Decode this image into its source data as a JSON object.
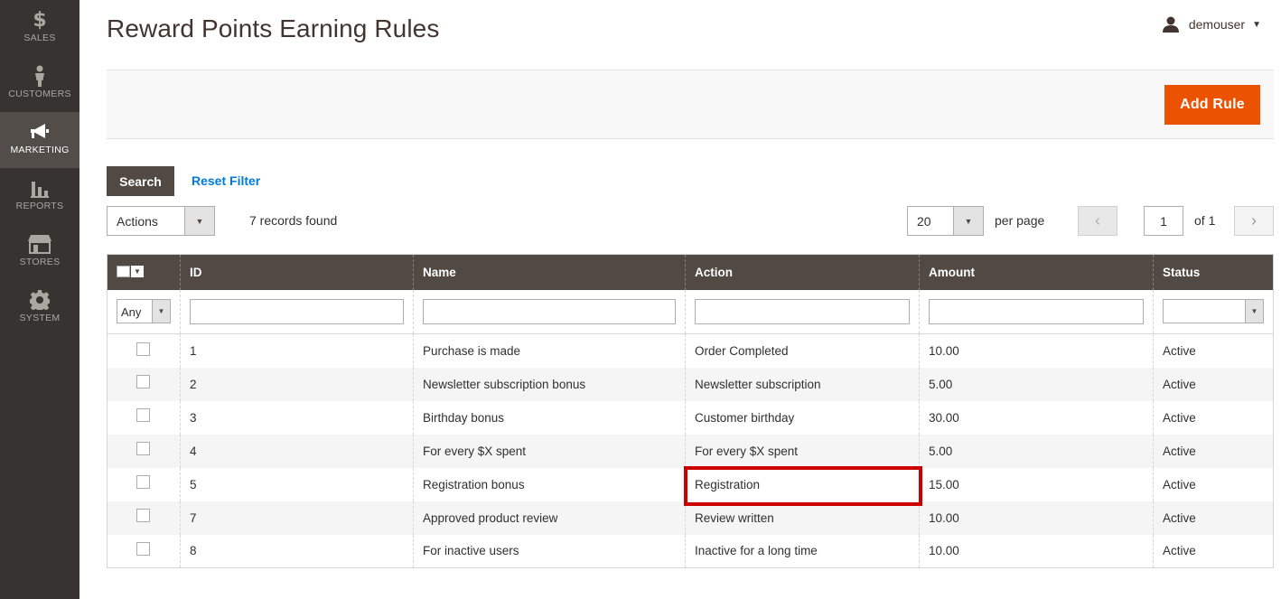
{
  "sidebar": {
    "items": [
      {
        "label": "SALES",
        "icon": "dollar-icon"
      },
      {
        "label": "CUSTOMERS",
        "icon": "person-icon"
      },
      {
        "label": "MARKETING",
        "icon": "megaphone-icon",
        "active": true
      },
      {
        "label": "REPORTS",
        "icon": "bar-chart-icon"
      },
      {
        "label": "STORES",
        "icon": "store-icon"
      },
      {
        "label": "SYSTEM",
        "icon": "gear-icon"
      }
    ]
  },
  "header": {
    "title": "Reward Points Earning Rules",
    "user": "demouser"
  },
  "actions_bar": {
    "add_label": "Add Rule",
    "accent": "#eb5202"
  },
  "filters": {
    "search_label": "Search",
    "reset_label": "Reset Filter",
    "actions_value": "Actions",
    "records_text": "7 records found"
  },
  "pager": {
    "per_page": "20",
    "per_page_label": "per page",
    "current_page": "1",
    "of_text": "of 1"
  },
  "grid": {
    "columns": [
      "ID",
      "Name",
      "Action",
      "Amount",
      "Status"
    ],
    "filter_any": "Any",
    "rows": [
      {
        "id": "1",
        "name": "Purchase is made",
        "action": "Order Completed",
        "amount": "10.00",
        "status": "Active"
      },
      {
        "id": "2",
        "name": "Newsletter subscription bonus",
        "action": "Newsletter subscription",
        "amount": "5.00",
        "status": "Active"
      },
      {
        "id": "3",
        "name": "Birthday bonus",
        "action": "Customer birthday",
        "amount": "30.00",
        "status": "Active"
      },
      {
        "id": "4",
        "name": "For every $X spent",
        "action": "For every $X spent",
        "amount": "5.00",
        "status": "Active"
      },
      {
        "id": "5",
        "name": "Registration bonus",
        "action": "Registration",
        "amount": "15.00",
        "status": "Active"
      },
      {
        "id": "7",
        "name": "Approved product review",
        "action": "Review written",
        "amount": "10.00",
        "status": "Active"
      },
      {
        "id": "8",
        "name": "For inactive users",
        "action": "Inactive for a long time",
        "amount": "10.00",
        "status": "Active"
      }
    ]
  },
  "colors": {
    "sidebar_bg": "#373330",
    "header_bg": "#514943",
    "highlight": "#cc0000",
    "link": "#007bdb"
  }
}
